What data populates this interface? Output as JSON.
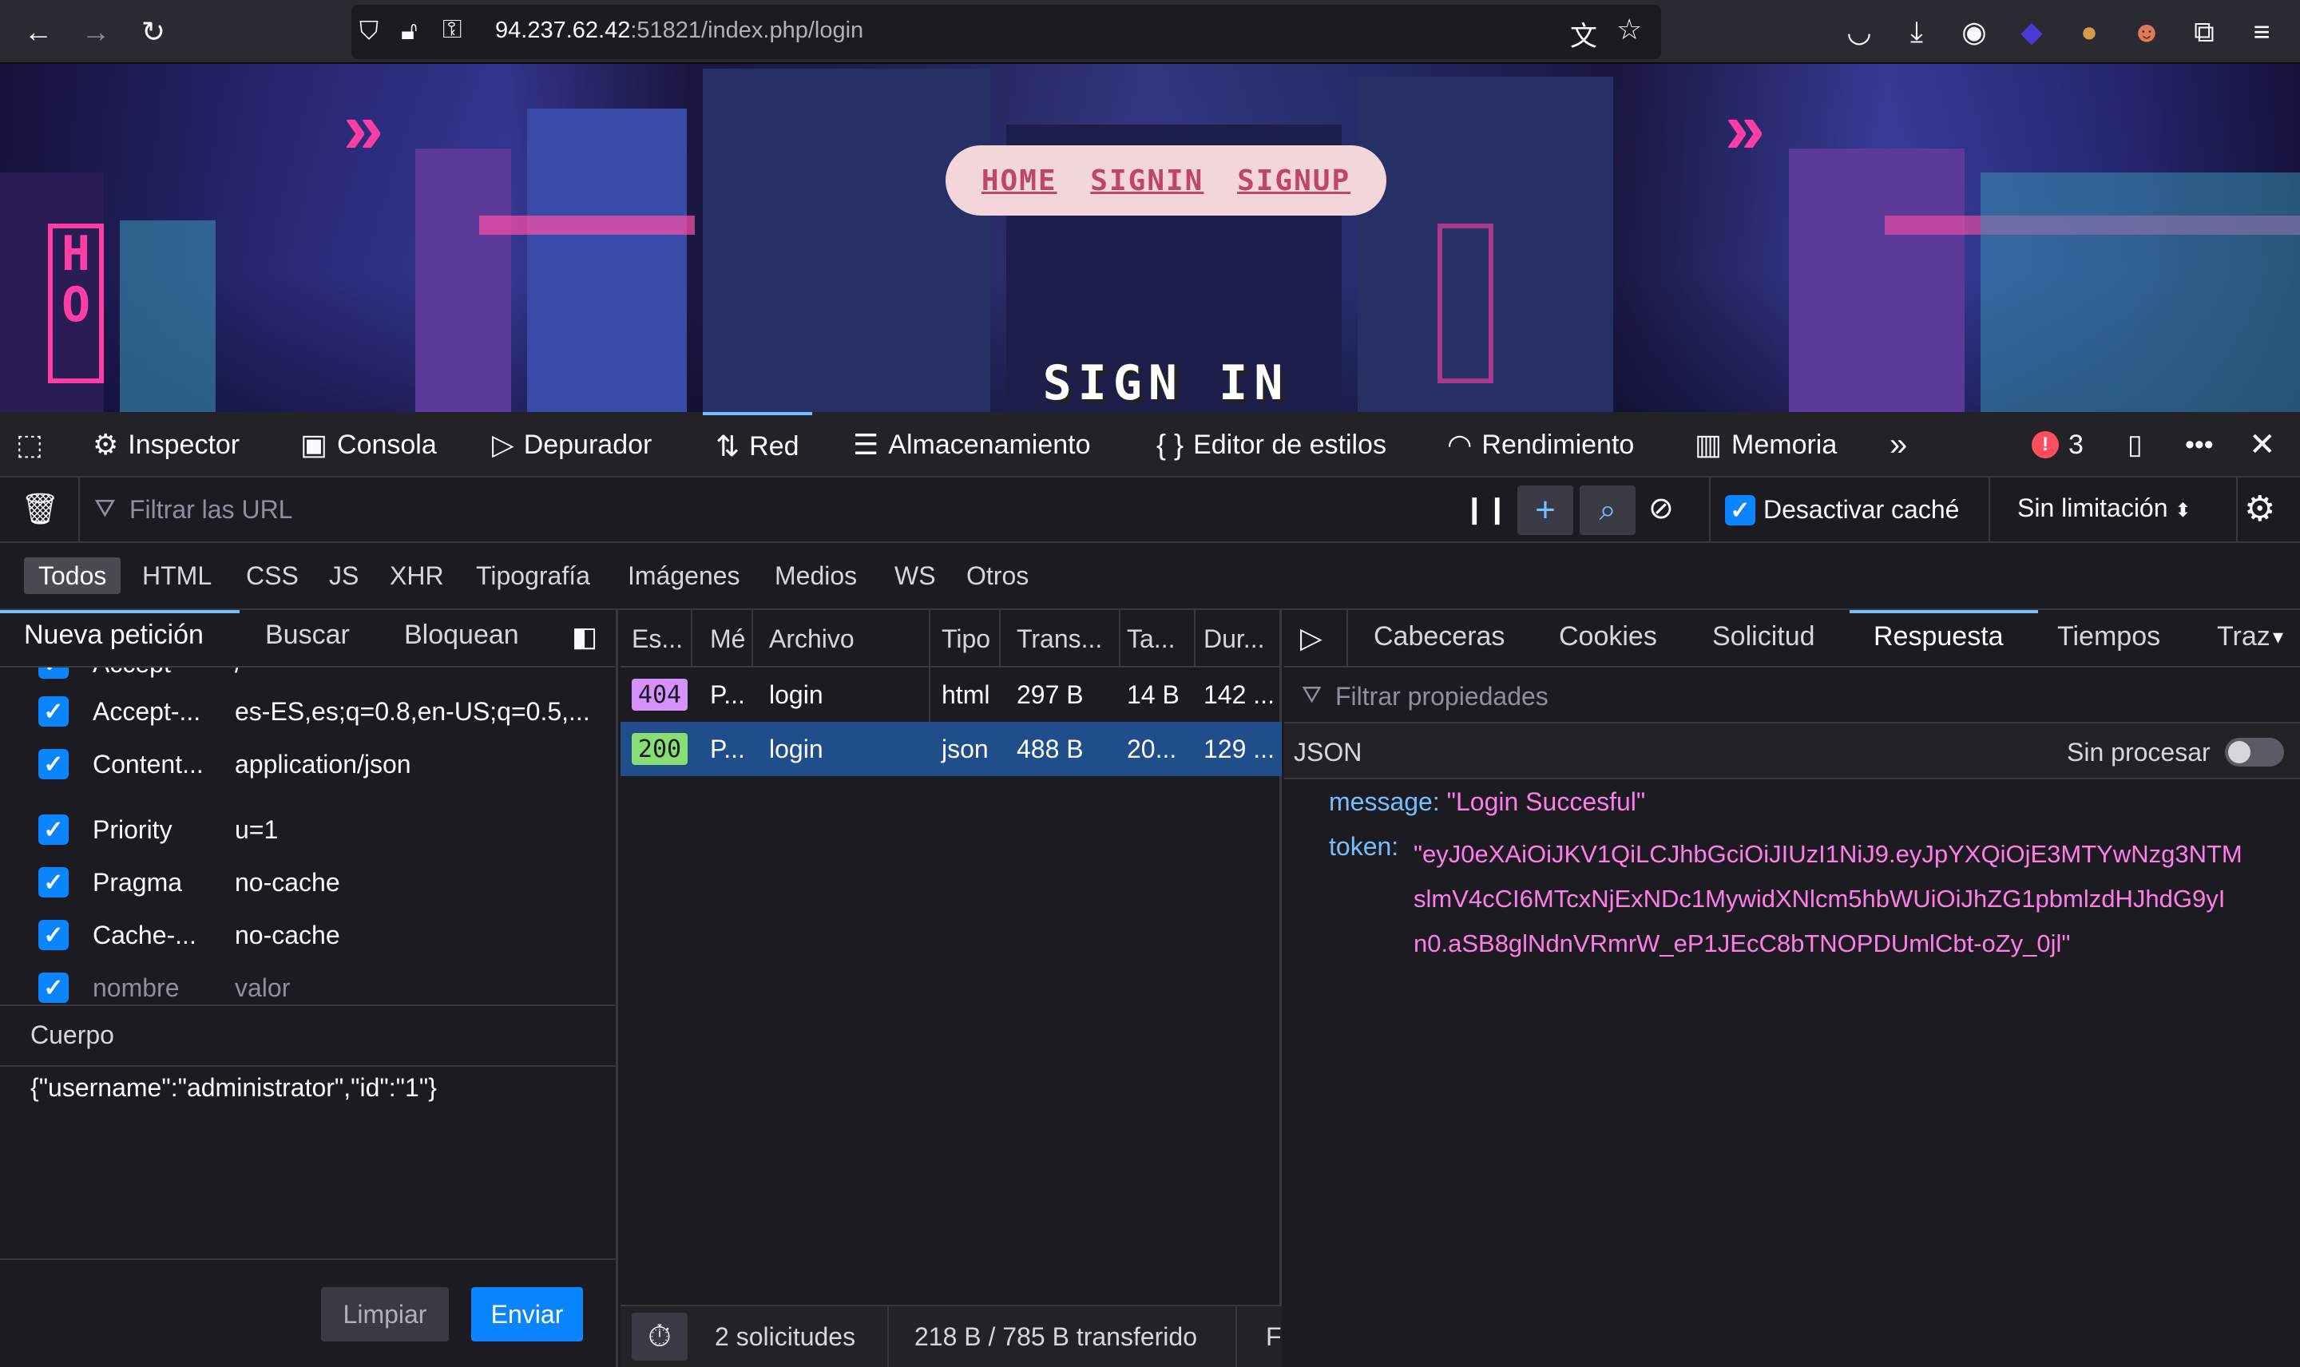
{
  "browser": {
    "url_host": "94.237.62.42",
    "url_rest": ":51821/index.php/login",
    "error_count": "3"
  },
  "page": {
    "nav": [
      "HOME",
      "SIGNIN",
      "SIGNUP"
    ],
    "heading": "SIGN IN"
  },
  "devtools": {
    "tabs": [
      "Inspector",
      "Consola",
      "Depurador",
      "Red",
      "Almacenamiento",
      "Editor de estilos",
      "Rendimiento",
      "Memoria"
    ],
    "filter_placeholder": "Filtrar las URL",
    "disable_cache_label": "Desactivar caché",
    "throttling": "Sin limitación",
    "types": [
      "Todos",
      "HTML",
      "CSS",
      "JS",
      "XHR",
      "Tipografía",
      "Imágenes",
      "Medios",
      "WS",
      "Otros"
    ]
  },
  "left_panel": {
    "tabs": [
      "Nueva petición",
      "Buscar",
      "Bloquean"
    ],
    "headers": [
      {
        "name": "Accept",
        "value": "/"
      },
      {
        "name": "Accept-...",
        "value": "es-ES,es;q=0.8,en-US;q=0.5,..."
      },
      {
        "name": "Content...",
        "value": "application/json"
      },
      {
        "name": "Priority",
        "value": "u=1"
      },
      {
        "name": "Pragma",
        "value": "no-cache"
      },
      {
        "name": "Cache-...",
        "value": "no-cache"
      }
    ],
    "new_header_name": "nombre",
    "new_header_value": "valor",
    "body_label": "Cuerpo",
    "body_text": "{\"username\":\"administrator\",\"id\":\"1\"}",
    "clear_label": "Limpiar",
    "send_label": "Enviar"
  },
  "requests": {
    "columns": [
      "Es...",
      "Mé",
      "Archivo",
      "Tipo",
      "Trans...",
      "Ta...",
      "Dur..."
    ],
    "rows": [
      {
        "status": "404",
        "method": "P...",
        "file": "login",
        "type": "html",
        "transferred": "297 B",
        "size": "14 B",
        "duration": "142 ..."
      },
      {
        "status": "200",
        "method": "P...",
        "file": "login",
        "type": "json",
        "transferred": "488 B",
        "size": "20...",
        "duration": "129 ..."
      }
    ],
    "footer_count": "2 solicitudes",
    "footer_transfer": "218 B / 785 B transferido",
    "footer_extra": "F"
  },
  "response": {
    "tabs": [
      "Cabeceras",
      "Cookies",
      "Solicitud",
      "Respuesta",
      "Tiempos",
      "Traz"
    ],
    "filter_placeholder": "Filtrar propiedades",
    "section": "JSON",
    "raw_label": "Sin procesar",
    "message_key": "message:",
    "message_value": "\"Login Succesful\"",
    "token_key": "token:",
    "token_line1": "\"eyJ0eXAiOiJKV1QiLCJhbGciOiJIUzI1NiJ9.eyJpYXQiOjE3MTYwNzg3NTM",
    "token_line2": "slmV4cCI6MTcxNjExNDc1MywidXNlcm5hbWUiOiJhZG1pbmlzdHJhdG9yI",
    "token_line3": "n0.aSB8glNdnVRmrW_eP1JEcC8bTNOPDUmlCbt-oZy_0jl\""
  },
  "colors": {
    "accent": "#0a84ff",
    "status_404": "#d592ff",
    "status_200": "#86de74",
    "json_key": "#75bfff",
    "json_string": "#ff7de9"
  }
}
